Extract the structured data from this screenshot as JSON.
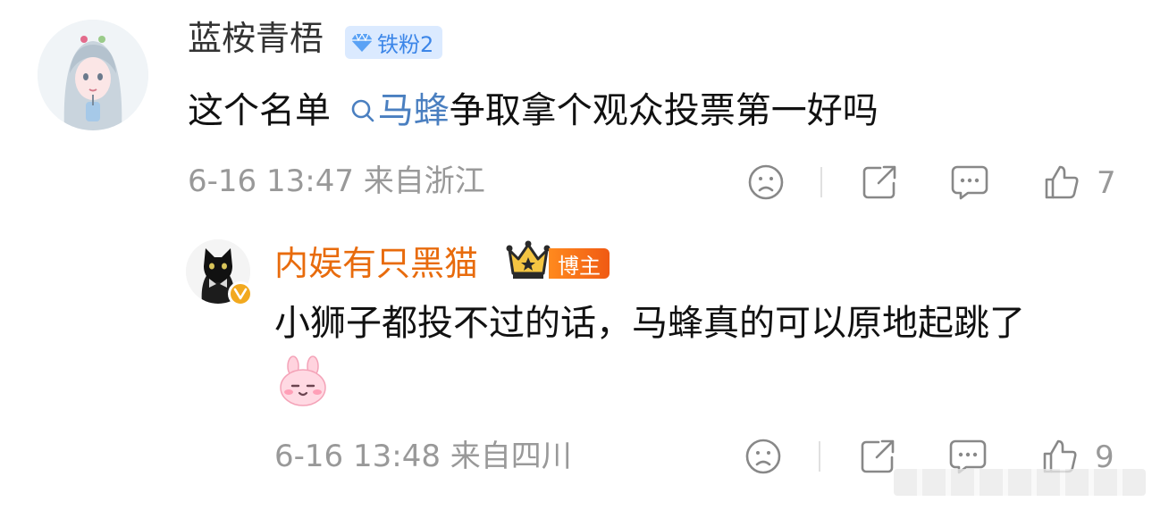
{
  "comment": {
    "user": {
      "name": "蓝桉青梧",
      "fan_badge": "铁粉2",
      "avatar_icon": "anime-girl-avatar"
    },
    "content": {
      "before": "这个名单",
      "topic": "马蜂",
      "after": "争取拿个观众投票第一好吗"
    },
    "meta": "6-16 13:47 来自浙江",
    "actions": {
      "dislike_icon": "sad-face-icon",
      "share_icon": "share-icon",
      "comment_icon": "comment-icon",
      "like_icon": "thumbs-up-icon",
      "like_count": "7"
    }
  },
  "reply": {
    "user": {
      "name": "内娱有只黑猫",
      "owner_badge": "博主",
      "avatar_icon": "black-cat-avatar",
      "verified_icon": "verified-v-icon",
      "crown_icon": "crown-icon"
    },
    "content": "小狮子都投不过的话，马蜂真的可以原地起跳了",
    "emoji_icon": "pink-bunny-emoji",
    "meta": "6-16 13:48 来自四川",
    "actions": {
      "dislike_icon": "sad-face-icon",
      "share_icon": "share-icon",
      "comment_icon": "comment-icon",
      "like_icon": "thumbs-up-icon",
      "like_count": "9"
    }
  },
  "colors": {
    "username": "#333333",
    "blogger_name": "#e86b0c",
    "topic_link": "#4a7fc0",
    "meta": "#999999",
    "fan_badge_bg": "#dbeaff",
    "owner_badge_bg": "#f05a13"
  }
}
